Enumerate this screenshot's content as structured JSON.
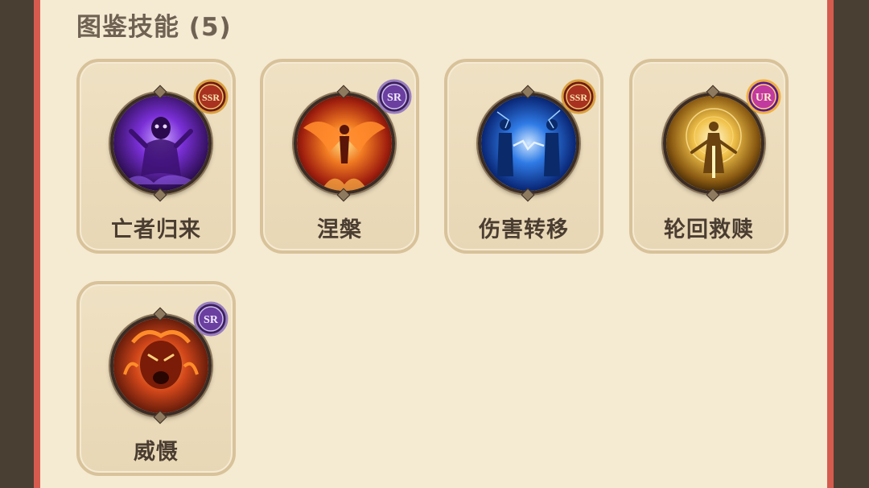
{
  "section": {
    "title": "图鉴技能",
    "count": "(5)"
  },
  "skills": [
    {
      "name": "亡者归来",
      "rarity": "SSR",
      "icon": "purple-ghost-icon",
      "theme": "#6b2fc9"
    },
    {
      "name": "涅槃",
      "rarity": "SR",
      "icon": "fire-phoenix-icon",
      "theme": "#e2561b"
    },
    {
      "name": "伤害转移",
      "rarity": "SSR",
      "icon": "blue-lightning-twins-icon",
      "theme": "#1f5fd6"
    },
    {
      "name": "轮回救赎",
      "rarity": "UR",
      "icon": "golden-light-figure-icon",
      "theme": "#e0a72a"
    },
    {
      "name": "威慑",
      "rarity": "SR",
      "icon": "fiery-roar-face-icon",
      "theme": "#d2471a"
    }
  ],
  "colors": {
    "frame": "#d65b4f",
    "panel": "#f5ead2",
    "card_border": "#d8c29a",
    "ssr_badge": "#a8321f",
    "sr_badge": "#6a3fa0",
    "ur_badge": "#c23aa0"
  }
}
